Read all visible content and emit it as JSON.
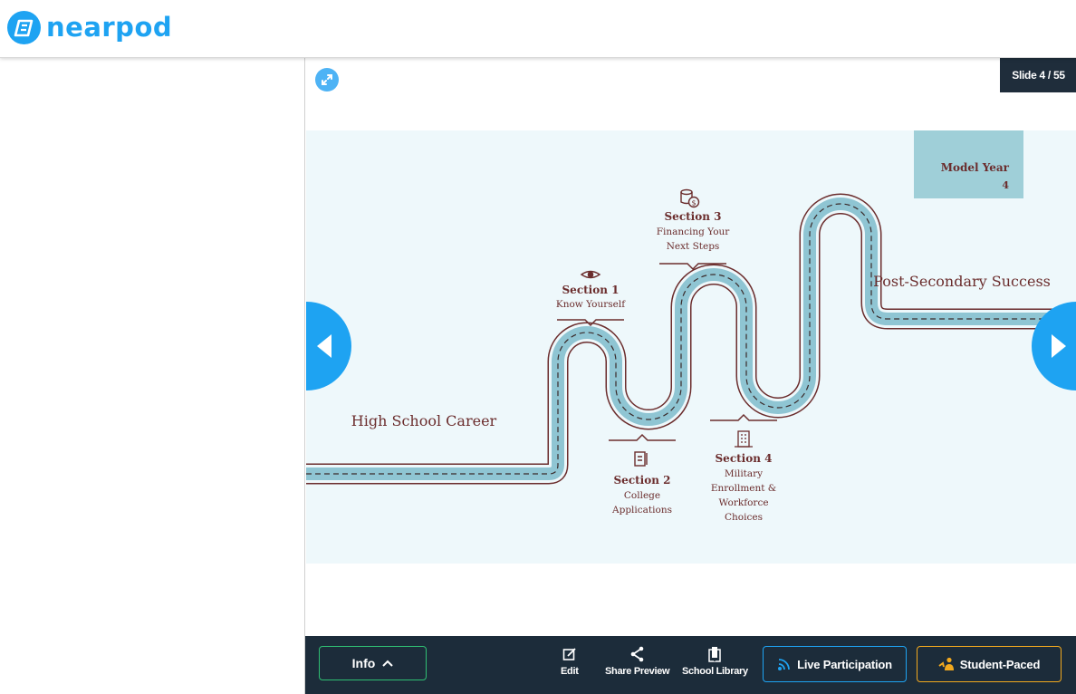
{
  "app": {
    "logo_text": "nearpod"
  },
  "viewer": {
    "slide_counter": "Slide 4 / 55"
  },
  "slide": {
    "model_year_line1": "Model Year",
    "model_year_line2": "4",
    "start_label": "High School Career",
    "end_label": "Post-Secondary Success",
    "sections": [
      {
        "title": "Section 1",
        "lines": [
          "Know Yourself"
        ],
        "icon": "eye-icon"
      },
      {
        "title": "Section 2",
        "lines": [
          "College",
          "Applications"
        ],
        "icon": "document-icon"
      },
      {
        "title": "Section 3",
        "lines": [
          "Financing Your",
          "Next Steps"
        ],
        "icon": "coins-icon"
      },
      {
        "title": "Section 4",
        "lines": [
          "Military",
          "Enrollment &",
          "Workforce",
          "Choices"
        ],
        "icon": "building-icon"
      }
    ],
    "colors": {
      "road": "#8fc5d3",
      "road_edge": "#6b2d2d",
      "text": "#6b2d2d",
      "background": "#eef8fb",
      "model_box": "#9fcfd8"
    }
  },
  "toolbar": {
    "info_label": "Info",
    "edit_label": "Edit",
    "share_label": "Share Preview",
    "library_label": "School Library",
    "live_label": "Live Participation",
    "student_paced_label": "Student-Paced"
  },
  "colors": {
    "brand": "#1ea3f2",
    "toolbar_bg": "#1c2c3a",
    "counter_bg": "#1f2d3b",
    "info_border": "#2fbf73",
    "student_paced_border": "#f2a91e"
  }
}
